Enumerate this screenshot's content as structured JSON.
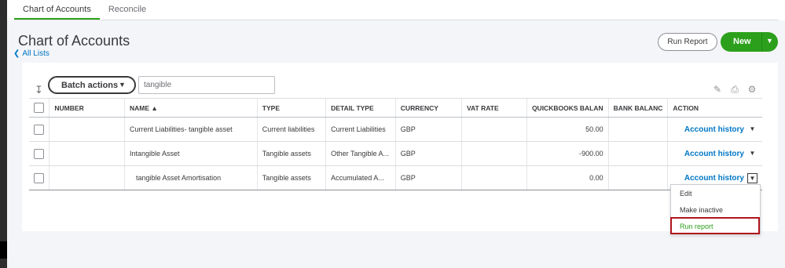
{
  "tabs": [
    {
      "label": "Chart of Accounts"
    },
    {
      "label": "Reconcile"
    }
  ],
  "header": {
    "title": "Chart of Accounts",
    "back_link": "All Lists",
    "run_report_label": "Run Report",
    "new_label": "New"
  },
  "toolbar": {
    "batch_actions_label": "Batch actions",
    "search_value": "tangible"
  },
  "table": {
    "columns": {
      "number": "NUMBER",
      "name": "NAME ▲",
      "type": "TYPE",
      "detail_type": "DETAIL TYPE",
      "currency": "CURRENCY",
      "vat_rate": "VAT RATE",
      "qb_balance": "QUICKBOOKS BALAN",
      "bank_balance": "BANK BALANC",
      "action": "ACTION"
    },
    "rows": [
      {
        "number": "",
        "name": "Current Liabilities- tangible asset",
        "type": "Current liabilities",
        "detail_type": "Current Liabilities",
        "currency": "GBP",
        "vat_rate": "",
        "qb_balance": "50.00",
        "bank_balance": "",
        "action": "Account history"
      },
      {
        "number": "",
        "name": "Intangible Asset",
        "type": "Tangible assets",
        "detail_type": "Other Tangible A...",
        "currency": "GBP",
        "vat_rate": "",
        "qb_balance": "-900.00",
        "bank_balance": "",
        "action": "Account history"
      },
      {
        "number": "",
        "name": "tangible Asset Amortisation",
        "type": "Tangible assets",
        "detail_type": "Accumulated A...",
        "currency": "GBP",
        "vat_rate": "",
        "qb_balance": "0.00",
        "bank_balance": "",
        "action": "Account history"
      }
    ]
  },
  "action_menu": {
    "items": [
      "Edit",
      "Make inactive",
      "Run report"
    ]
  },
  "colors": {
    "brand_green": "#2ca01c",
    "link_blue": "#0077c5",
    "highlight_red": "#b0151c"
  },
  "icons": {
    "sort": "sort-arrow-icon",
    "edit": "pencil-icon",
    "print": "printer-icon",
    "settings": "gear-icon"
  }
}
